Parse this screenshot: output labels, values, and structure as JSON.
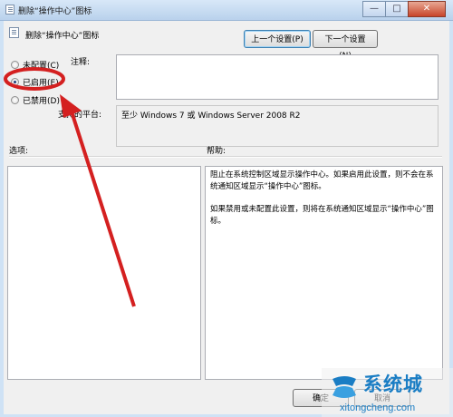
{
  "window": {
    "title": "删除“操作中心”图标",
    "controls": {
      "minimize": "—",
      "maximize": "□",
      "close": "✕"
    }
  },
  "header": {
    "title": "删除“操作中心”图标",
    "prev_button": "上一个设置(P)",
    "next_button": "下一个设置(N)"
  },
  "state_options": [
    {
      "label": "未配置(C)",
      "checked": false
    },
    {
      "label": "已启用(E)",
      "checked": true
    },
    {
      "label": "已禁用(D)",
      "checked": false
    }
  ],
  "comment": {
    "label": "注释:",
    "value": ""
  },
  "platform": {
    "label": "支持的平台:",
    "value": "至少 Windows 7 或 Windows Server 2008 R2"
  },
  "options": {
    "label": "选项:"
  },
  "help": {
    "label": "帮助:",
    "paragraphs": [
      "阻止在系统控制区域显示操作中心。如果启用此设置，则不会在系统通知区域显示“操作中心”图标。",
      "如果禁用或未配置此设置，则将在系统通知区域显示“操作中心”图标。"
    ]
  },
  "footer": {
    "ok_button": "确定",
    "cancel_button": "取消"
  },
  "watermark": {
    "brand": "系统城",
    "url": "xitongcheng.com"
  },
  "colors": {
    "annotation_red": "#d42020",
    "watermark_blue": "#1a7dc4"
  }
}
